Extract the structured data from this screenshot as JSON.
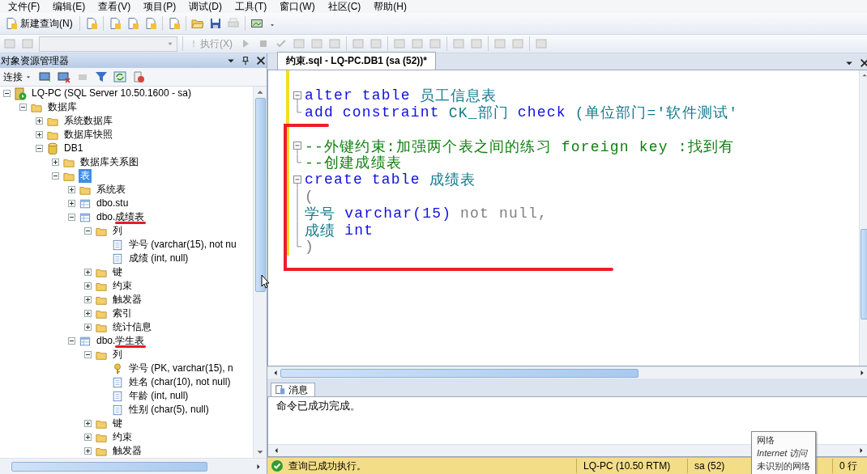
{
  "menu": [
    {
      "label": "文件(F)"
    },
    {
      "label": "编辑(E)"
    },
    {
      "label": "查看(V)"
    },
    {
      "label": "项目(P)"
    },
    {
      "label": "调试(D)"
    },
    {
      "label": "工具(T)"
    },
    {
      "label": "窗口(W)"
    },
    {
      "label": "社区(C)"
    },
    {
      "label": "帮助(H)"
    }
  ],
  "toolbar": {
    "new_query": "新建查询(N)",
    "execute": {
      "label": "执行(X)",
      "disabled": true
    },
    "database_select": {
      "disabled": true
    }
  },
  "object_explorer": {
    "title": "对象资源管理器",
    "connect": "连接",
    "tree": [
      {
        "label": "LQ-PC (SQL Server 10.50.1600 - sa)",
        "kind": "server",
        "expanded": true,
        "children": [
          {
            "label": "数据库",
            "kind": "folder",
            "expanded": true,
            "children": [
              {
                "label": "系统数据库",
                "kind": "folder",
                "expanded": false
              },
              {
                "label": "数据库快照",
                "kind": "folder",
                "expanded": false
              },
              {
                "label": "DB1",
                "kind": "database",
                "expanded": true,
                "children": [
                  {
                    "label": "数据库关系图",
                    "kind": "folder",
                    "expanded": false
                  },
                  {
                    "label": "表",
                    "kind": "folder",
                    "expanded": true,
                    "selected": true,
                    "children": [
                      {
                        "label": "系统表",
                        "kind": "folder",
                        "expanded": false
                      },
                      {
                        "label": "dbo.stu",
                        "kind": "table",
                        "expanded": false
                      },
                      {
                        "label": "dbo.成绩表",
                        "kind": "table",
                        "expanded": true,
                        "underlined": true,
                        "children": [
                          {
                            "label": "列",
                            "kind": "folder",
                            "expanded": true,
                            "children": [
                              {
                                "label": "学号 (varchar(15), not nu",
                                "kind": "column"
                              },
                              {
                                "label": "成绩 (int, null)",
                                "kind": "column"
                              }
                            ]
                          },
                          {
                            "label": "键",
                            "kind": "folder",
                            "expanded": false
                          },
                          {
                            "label": "约束",
                            "kind": "folder",
                            "expanded": false
                          },
                          {
                            "label": "触发器",
                            "kind": "folder",
                            "expanded": false
                          },
                          {
                            "label": "索引",
                            "kind": "folder",
                            "expanded": false
                          },
                          {
                            "label": "统计信息",
                            "kind": "folder",
                            "expanded": false
                          }
                        ]
                      },
                      {
                        "label": "dbo.学生表",
                        "kind": "table",
                        "expanded": true,
                        "underlined": true,
                        "children": [
                          {
                            "label": "列",
                            "kind": "folder",
                            "expanded": true,
                            "children": [
                              {
                                "label": "学号 (PK, varchar(15), n",
                                "kind": "key"
                              },
                              {
                                "label": "姓名 (char(10), not null)",
                                "kind": "column"
                              },
                              {
                                "label": "年龄 (int, null)",
                                "kind": "column"
                              },
                              {
                                "label": "性别 (char(5), null)",
                                "kind": "column"
                              }
                            ]
                          },
                          {
                            "label": "键",
                            "kind": "folder",
                            "expanded": false
                          },
                          {
                            "label": "约束",
                            "kind": "folder",
                            "expanded": false
                          },
                          {
                            "label": "触发器",
                            "kind": "folder",
                            "expanded": false
                          }
                        ]
                      }
                    ]
                  }
                ]
              }
            ]
          }
        ]
      }
    ]
  },
  "editor": {
    "tab": {
      "title": "约束.sql - LQ-PC.DB1 (sa (52))*",
      "selected": true
    },
    "lines": [
      {
        "kind": "blank",
        "changed": true
      },
      {
        "kind": "start",
        "changed": true,
        "tokens": [
          {
            "kind": "keyword",
            "text": "alter"
          },
          {
            "kind": "keyword",
            "text": "table"
          },
          {
            "kind": "ident",
            "text": "员工信息表"
          }
        ]
      },
      {
        "kind": "end",
        "changed": true,
        "tokens": [
          {
            "kind": "keyword",
            "text": "add"
          },
          {
            "kind": "keyword",
            "text": "constraint"
          },
          {
            "kind": "ident",
            "text": "CK_部门"
          },
          {
            "kind": "keyword",
            "text": "check"
          },
          {
            "kind": "ident",
            "text": "(单位部门='软件测试'"
          }
        ]
      },
      {
        "kind": "blank",
        "changed": true
      },
      {
        "kind": "start",
        "changed": true,
        "tokens": [
          {
            "kind": "comment",
            "text": "--外键约束:加强两个表之间的练习 foreign key :找到有"
          }
        ]
      },
      {
        "kind": "end",
        "changed": true,
        "tokens": [
          {
            "kind": "comment",
            "text": "--创建成绩表"
          }
        ]
      },
      {
        "kind": "start",
        "changed": true,
        "tokens": [
          {
            "kind": "keyword",
            "text": "create"
          },
          {
            "kind": "keyword",
            "text": "table"
          },
          {
            "kind": "ident",
            "text": "成绩表"
          }
        ]
      },
      {
        "kind": "body",
        "changed": true,
        "tokens": [
          {
            "kind": "gray",
            "text": "("
          }
        ]
      },
      {
        "kind": "body",
        "changed": true,
        "tokens": [
          {
            "kind": "ident",
            "text": "学号"
          },
          {
            "kind": "keyword",
            "text": "varchar(15)"
          },
          {
            "kind": "gray",
            "text": "not null,"
          }
        ]
      },
      {
        "kind": "body",
        "changed": true,
        "tokens": [
          {
            "kind": "ident",
            "text": "成绩"
          },
          {
            "kind": "keyword",
            "text": "int"
          }
        ]
      },
      {
        "kind": "end",
        "changed": true,
        "tokens": [
          {
            "kind": "gray",
            "text": ")"
          }
        ]
      }
    ]
  },
  "messages": {
    "tab": {
      "label": "消息",
      "selected": true
    },
    "text": "命令已成功完成。"
  },
  "status_bar": {
    "message": "查询已成功执行。",
    "server": "LQ-PC (10.50 RTM)",
    "user": "sa (52)",
    "rows": "0 行"
  },
  "tooltip": {
    "lines": [
      {
        "text": "网络",
        "italic": false
      },
      {
        "text": "Internet 访问",
        "italic": true
      },
      {
        "text": "未识别的网络",
        "italic": false
      }
    ]
  }
}
